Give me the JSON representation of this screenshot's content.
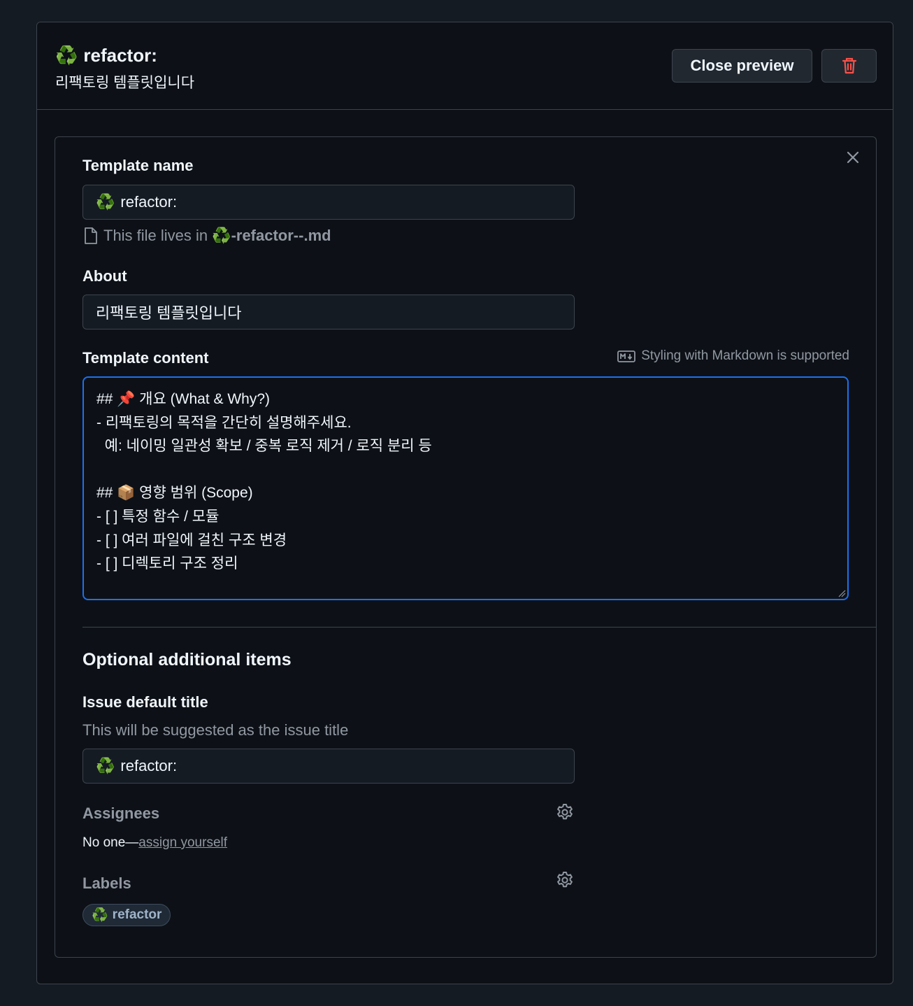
{
  "header": {
    "title_emoji": "♻️",
    "title": "refactor:",
    "subtitle": "리팩토링 템플릿입니다",
    "close_preview_label": "Close preview"
  },
  "form": {
    "template_name": {
      "label": "Template name",
      "value_emoji": "♻️",
      "value": "refactor:",
      "file_hint_prefix": "This file lives in",
      "file_emoji": "♻️",
      "file_name": "-refactor--.md"
    },
    "about": {
      "label": "About",
      "value": "리팩토링 템플릿입니다"
    },
    "content": {
      "label": "Template content",
      "markdown_note": "Styling with Markdown is supported",
      "lines": [
        "## 📌 개요 (What & Why?)",
        "- 리팩토링의 목적을 간단히 설명해주세요.",
        "  예: 네이밍 일관성 확보 / 중복 로직 제거 / 로직 분리 등",
        "",
        "## 📦 영향 범위 (Scope)",
        "- [ ] 특정 함수 / 모듈",
        "- [ ] 여러 파일에 걸친 구조 변경",
        "- [ ] 디렉토리 구조 정리"
      ]
    }
  },
  "optional": {
    "heading": "Optional additional items",
    "issue_title": {
      "label": "Issue default title",
      "hint": "This will be suggested as the issue title",
      "value_emoji": "♻️",
      "value": "refactor:"
    },
    "assignees": {
      "label": "Assignees",
      "none_text": "No one—",
      "assign_link": "assign yourself"
    },
    "labels": {
      "label": "Labels",
      "items": [
        {
          "emoji": "♻️",
          "name": "refactor"
        }
      ]
    }
  },
  "colors": {
    "accent": "#1f6feb",
    "danger": "#f85149",
    "recycle": "#2ea043"
  },
  "icons": [
    "recycle-icon",
    "trash-icon",
    "close-icon",
    "file-icon",
    "markdown-icon",
    "gear-icon",
    "resize-handle-icon"
  ]
}
